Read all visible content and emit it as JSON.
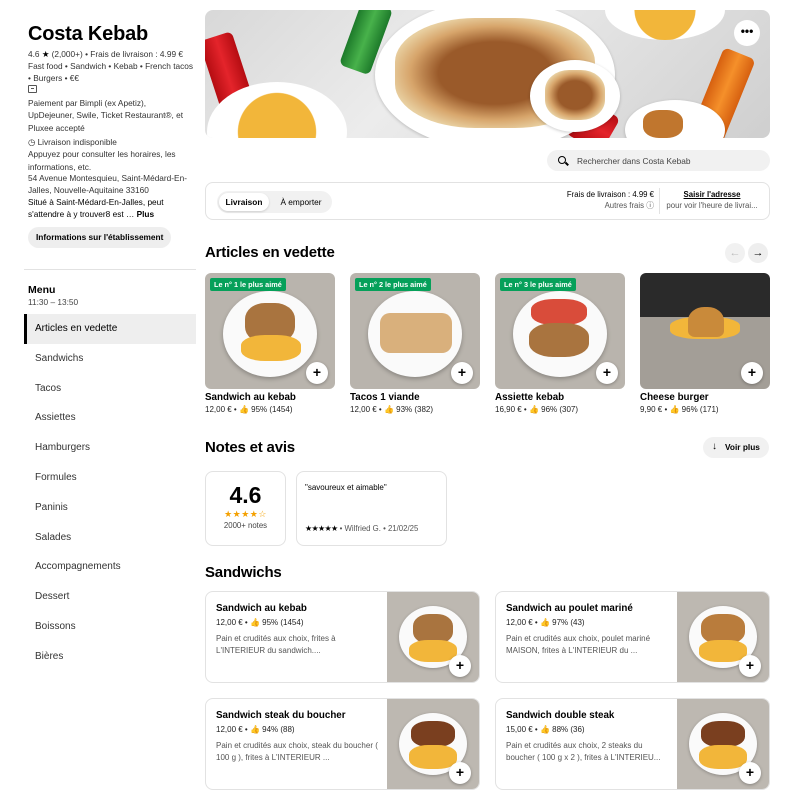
{
  "store": {
    "name": "Costa Kebab",
    "rating": "4.6",
    "rating_count": "(2,000+)",
    "delivery_fee_short": "Frais de livraison : 4.99 €",
    "categories": "Fast food • Sandwich • Kebab • French tacos • Burgers • €€",
    "payment": "Paiement par Bimpli (ex Apetiz), UpDejeuner, Swile, Ticket Restaurant®, et Pluxee accepté",
    "delivery_status": "Livraison indisponible",
    "hours_hint": "Appuyez pour consulter les horaires, les informations, etc.",
    "address": "54 Avenue Montesquieu, Saint-Médard-En-Jalles, Nouvelle-Aquitaine 33160",
    "directions": "Situé à Saint-Médard-En-Jalles, peut s'attendre à y trouver8 est …",
    "directions_more": "Plus",
    "info_button": "Informations sur l'établissement"
  },
  "menu": {
    "title": "Menu",
    "hours": "11:30 – 13:50",
    "items": [
      "Articles en vedette",
      "Sandwichs",
      "Tacos",
      "Assiettes",
      "Hamburgers",
      "Formules",
      "Paninis",
      "Salades",
      "Accompagnements",
      "Dessert",
      "Boissons",
      "Bières"
    ]
  },
  "hero": {
    "more_label": "•••"
  },
  "search": {
    "placeholder": "Rechercher dans Costa Kebab"
  },
  "order": {
    "delivery_label": "Livraison",
    "pickup_label": "À emporter",
    "fee_label": "Frais de livraison : 4.99 €",
    "other_fees": "Autres frais ⓘ",
    "address_link": "Saisir l'adresse",
    "address_sub": "pour voir l'heure de livrai..."
  },
  "featured": {
    "title": "Articles en vedette",
    "prev_label": "←",
    "next_label": "→",
    "items": [
      {
        "badge": "Le n° 1 le plus aimé",
        "name": "Sandwich au kebab",
        "meta": "12,00 € • 👍 95% (1454)"
      },
      {
        "badge": "Le n° 2 le plus aimé",
        "name": "Tacos 1 viande",
        "meta": "12,00 € • 👍 93% (382)"
      },
      {
        "badge": "Le n° 3 le plus aimé",
        "name": "Assiette kebab",
        "meta": "16,90 € • 👍 96% (307)"
      },
      {
        "badge": "",
        "name": "Cheese burger",
        "meta": "9,90 € • 👍 96% (171)"
      }
    ]
  },
  "reviews": {
    "title": "Notes et avis",
    "see_more": "Voir plus",
    "rating": "4.6",
    "stars": "★★★★☆",
    "count": "2000+ notes",
    "review_text": "\"savoureux et aimable\"",
    "review_stars": "★★★★★",
    "review_author": " • Wilfried G. • 21/02/25"
  },
  "sandwichs": {
    "title": "Sandwichs",
    "items": [
      {
        "name": "Sandwich au kebab",
        "meta": "12,00 € • 👍 95% (1454)",
        "desc": "Pain et crudités aux choix, frites à L'INTERIEUR du sandwich...."
      },
      {
        "name": "Sandwich au poulet mariné",
        "meta": "12,00 € • 👍 97% (43)",
        "desc": "Pain et crudités aux choix, poulet mariné MAISON, frites à L'INTERIEUR du ..."
      },
      {
        "name": "Sandwich steak du boucher",
        "meta": "12,00 € • 👍 94% (88)",
        "desc": "Pain et crudités aux choix, steak du boucher ( 100 g ), frites à L'INTERIEUR ..."
      },
      {
        "name": "Sandwich double steak",
        "meta": "15,00 € • 👍 88% (36)",
        "desc": "Pain et crudités aux choix, 2 steaks du boucher ( 100 g x 2 ), frites à L'INTERIEU..."
      }
    ]
  },
  "plus_label": "+"
}
